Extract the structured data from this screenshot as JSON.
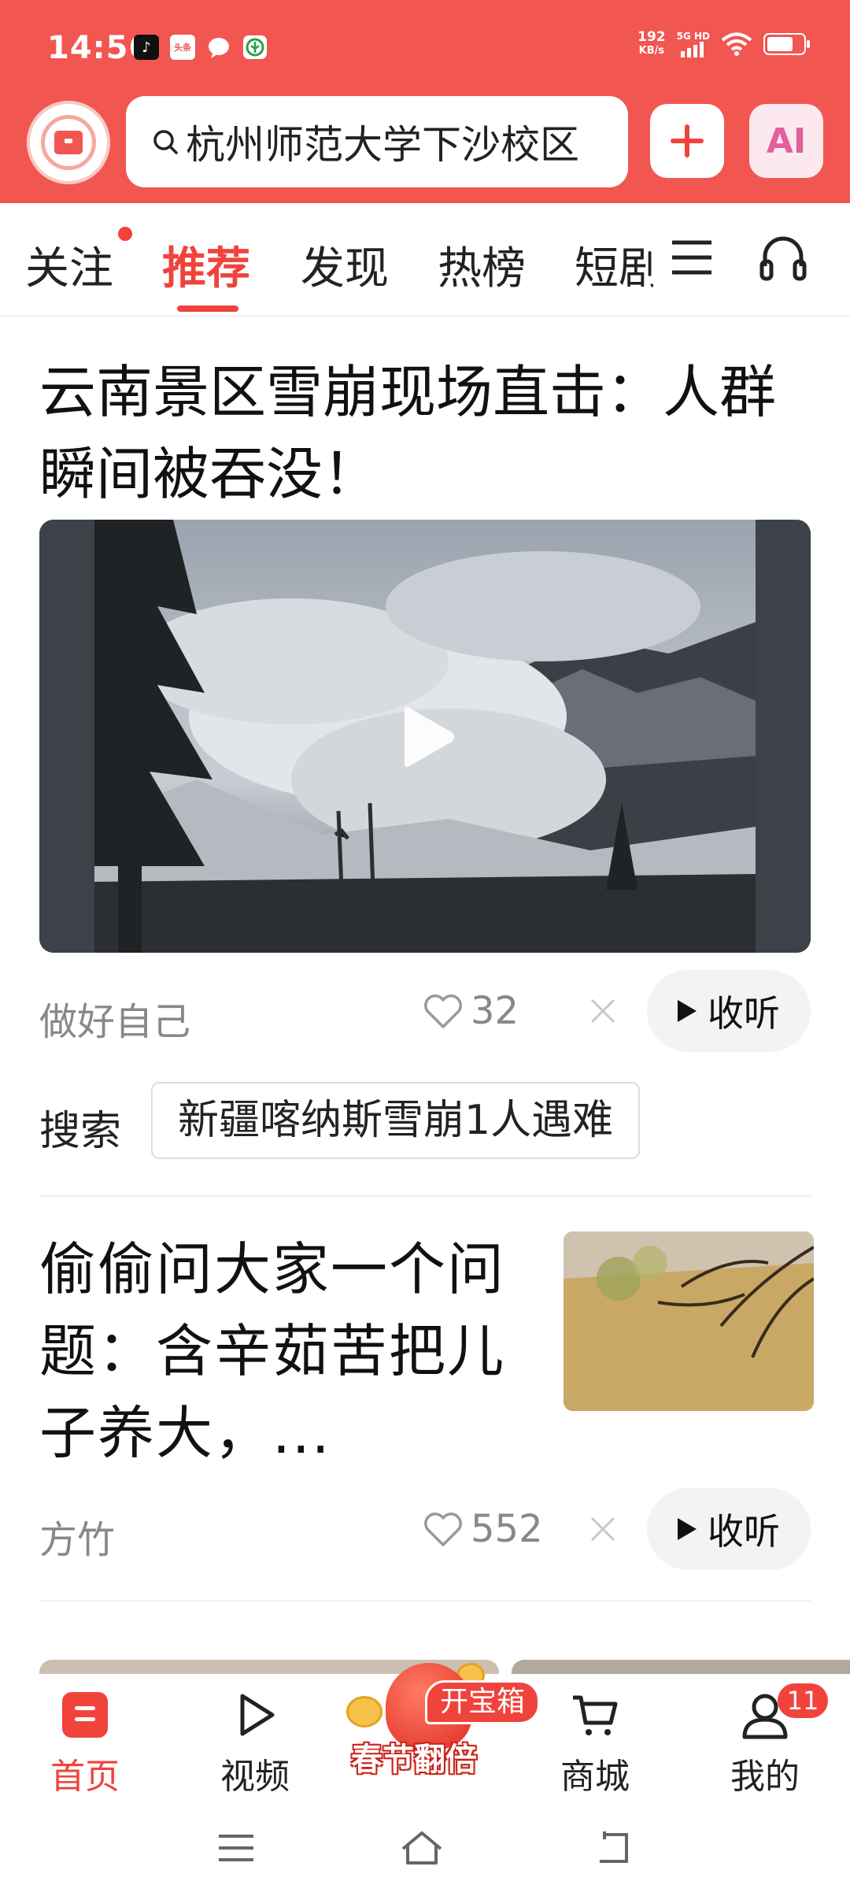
{
  "status_bar": {
    "time": "14:56",
    "net_speed_value": "192",
    "net_speed_unit": "KB/s",
    "network_label": "5G HD",
    "app_icons": [
      "tiktok-icon",
      "toutiao-icon",
      "chat-icon",
      "leaf-icon"
    ],
    "toutiao_text": "头条"
  },
  "header": {
    "search_text": "杭州师范大学下沙校区",
    "ai_label": "AI",
    "accent_color": "#f25651"
  },
  "tabs": {
    "items": [
      "关注",
      "推荐",
      "发现",
      "热榜",
      "短剧"
    ],
    "active": "推荐"
  },
  "article1": {
    "title": "云南景区雪崩现场直击：人群瞬间被吞没！",
    "author": "做好自己",
    "likes": "32",
    "listen_label": "收听",
    "search_label": "搜索",
    "search_suggestion": "新疆喀纳斯雪崩1人遇难"
  },
  "article2": {
    "title": "偷偷问大家一个问题：含辛茹苦把儿子养大，...",
    "author": "方竹",
    "likes": "552",
    "listen_label": "收听"
  },
  "bottom_nav": {
    "items": [
      {
        "label": "首页",
        "icon": "home-icon"
      },
      {
        "label": "视频",
        "icon": "video-play-icon"
      },
      {
        "label": "商城",
        "icon": "cart-icon"
      },
      {
        "label": "我的",
        "icon": "user-icon"
      }
    ],
    "active": "首页",
    "profile_badge": "11",
    "promo_tag": "开宝箱",
    "promo_title": "春节翻倍"
  },
  "system_nav": [
    "menu-icon",
    "home-outline-icon",
    "back-icon"
  ]
}
